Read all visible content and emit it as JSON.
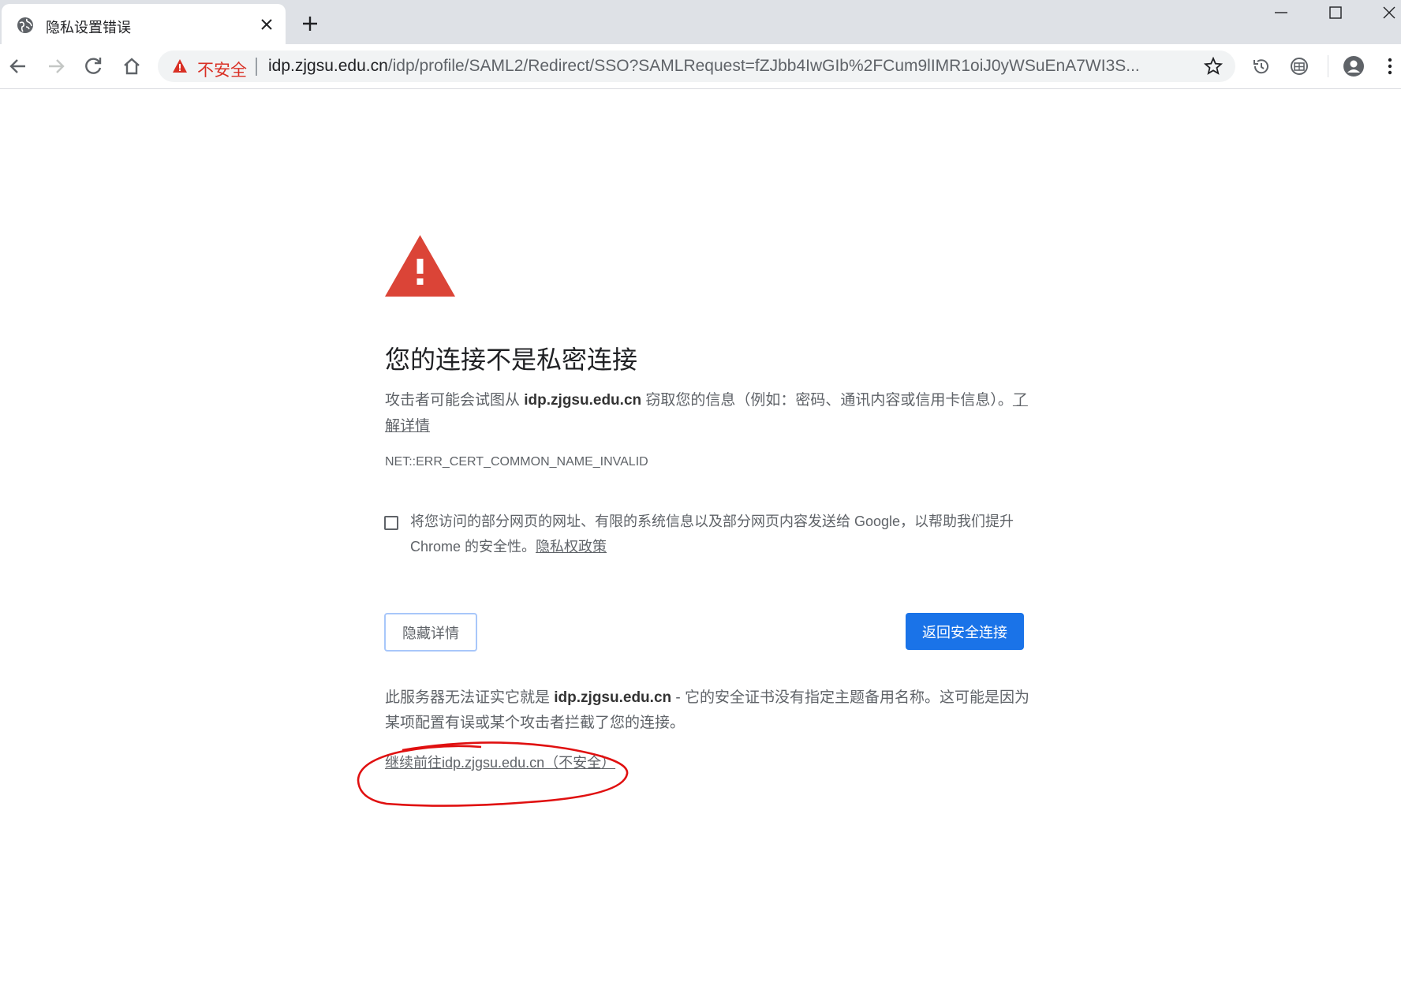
{
  "tab": {
    "title": "隐私设置错误",
    "favicon": "globe-icon"
  },
  "window_controls": [
    "minimize-icon",
    "maximize-icon",
    "close-icon"
  ],
  "omnibox": {
    "security_label": "不安全",
    "url_host": "idp.zjgsu.edu.cn",
    "url_path": "/idp/profile/SAML2/Redirect/SSO?SAMLRequest=fZJbb4IwGIb%2FCum9lIMR1oiJ0yWSuEnA7WI3S..."
  },
  "page": {
    "heading": "您的连接不是私密连接",
    "main_prefix": "攻击者可能会试图从 ",
    "main_host": "idp.zjgsu.edu.cn",
    "main_suffix": " 窃取您的信息（例如：密码、通讯内容或信用卡信息）。",
    "learn_more": "了解详情",
    "error_code": "NET::ERR_CERT_COMMON_NAME_INVALID",
    "optin_text": "将您访问的部分网页的网址、有限的系统信息以及部分网页内容发送给 Google，以帮助我们提升 Chrome 的安全性。",
    "privacy_policy": "隐私权政策",
    "details_button": "隐藏详情",
    "back_button": "返回安全连接",
    "details_prefix": "此服务器无法证实它就是 ",
    "details_host": "idp.zjgsu.edu.cn",
    "details_suffix": " - 它的安全证书没有指定主题备用名称。这可能是因为某项配置有误或某个攻击者拦截了您的连接。",
    "proceed_link": "继续前往idp.zjgsu.edu.cn（不安全）"
  },
  "colors": {
    "warning_red": "#d93025",
    "button_blue": "#1a73e8",
    "annotation_red": "#e01010"
  }
}
